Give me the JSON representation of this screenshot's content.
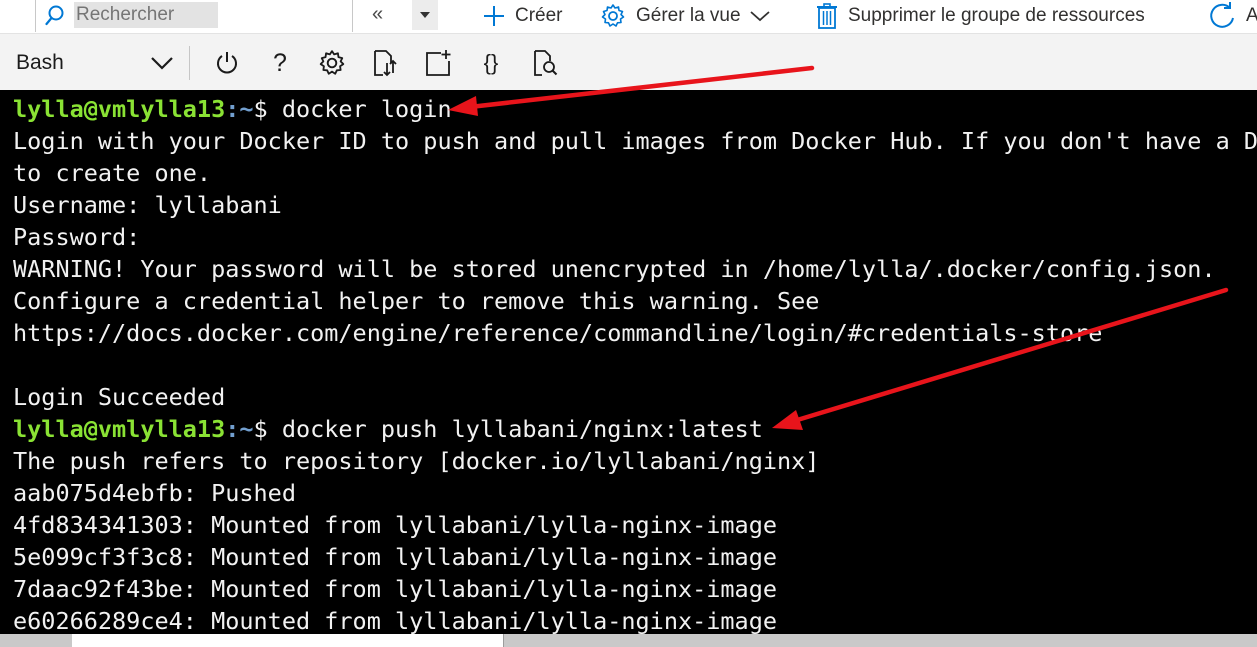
{
  "topbar": {
    "search_placeholder": "Rechercher",
    "collapse_glyph": "«",
    "commands": [
      {
        "label": "Créer",
        "icon": "plus-icon"
      },
      {
        "label": "Gérer la vue",
        "icon": "gear-icon"
      },
      {
        "label": "Supprimer le groupe de ressources",
        "icon": "trash-icon"
      },
      {
        "label": "A",
        "icon": "refresh-icon"
      }
    ]
  },
  "shell": {
    "selected_shell": "Bash",
    "tools": [
      {
        "name": "power-icon",
        "glyph": ""
      },
      {
        "name": "help-icon",
        "glyph": "?"
      },
      {
        "name": "settings-icon",
        "glyph": ""
      },
      {
        "name": "upload-download-icon",
        "glyph": ""
      },
      {
        "name": "new-session-icon",
        "glyph": ""
      },
      {
        "name": "editor-icon",
        "glyph": "{}"
      },
      {
        "name": "web-preview-icon",
        "glyph": ""
      }
    ]
  },
  "terminal": {
    "prompt_user": "lylla@vmlylla13",
    "prompt_path": ":~",
    "prompt_sign": "$ ",
    "lines": [
      {
        "type": "prompt",
        "command": "docker login"
      },
      {
        "type": "out",
        "text": "Login with your Docker ID to push and pull images from Docker Hub. If you don't have a Do"
      },
      {
        "type": "out",
        "text": "to create one."
      },
      {
        "type": "out",
        "text": "Username: lyllabani"
      },
      {
        "type": "out",
        "text": "Password:"
      },
      {
        "type": "out",
        "text": "WARNING! Your password will be stored unencrypted in /home/lylla/.docker/config.json."
      },
      {
        "type": "out",
        "text": "Configure a credential helper to remove this warning. See"
      },
      {
        "type": "out",
        "text": "https://docs.docker.com/engine/reference/commandline/login/#credentials-store"
      },
      {
        "type": "out",
        "text": ""
      },
      {
        "type": "out",
        "text": "Login Succeeded"
      },
      {
        "type": "prompt",
        "command": "docker push lyllabani/nginx:latest"
      },
      {
        "type": "out",
        "text": "The push refers to repository [docker.io/lyllabani/nginx]"
      },
      {
        "type": "out",
        "text": "aab075d4ebfb: Pushed"
      },
      {
        "type": "out",
        "text": "4fd834341303: Mounted from lyllabani/lylla-nginx-image"
      },
      {
        "type": "out",
        "text": "5e099cf3f3c8: Mounted from lyllabani/lylla-nginx-image"
      },
      {
        "type": "out",
        "text": "7daac92f43be: Mounted from lyllabani/lylla-nginx-image"
      },
      {
        "type": "out",
        "text": "e60266289ce4: Mounted from lyllabani/lylla-nginx-image"
      }
    ]
  },
  "colors": {
    "terminal_bg": "#000000",
    "prompt_user": "#8ae234",
    "prompt_path": "#729fcf",
    "azure_blue": "#0078d4",
    "annotation_arrow": "#e8141b"
  }
}
